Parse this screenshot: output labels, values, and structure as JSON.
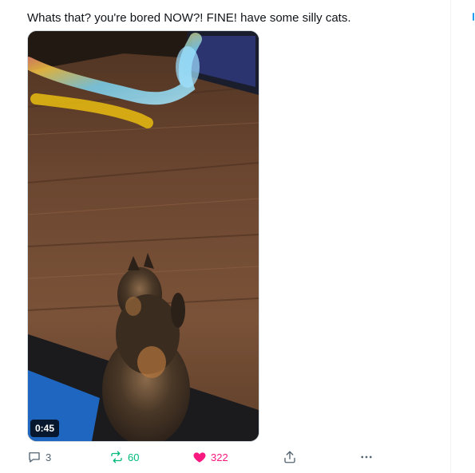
{
  "post": {
    "text": "Whats that? you're bored NOW?! FINE! have some silly cats."
  },
  "media": {
    "description_icon": "video-thumbnail",
    "duration": "0:45"
  },
  "actions": {
    "replies": "3",
    "reposts": "60",
    "likes": "322",
    "reply_icon": "reply-icon",
    "repost_icon": "repost-icon",
    "like_icon": "heart-icon",
    "share_icon": "share-icon",
    "more_icon": "more-icon"
  },
  "colors": {
    "text": "#0f1419",
    "muted": "#536471",
    "repost": "#00ba7c",
    "like": "#f91880",
    "accent": "#1d9bf0"
  }
}
